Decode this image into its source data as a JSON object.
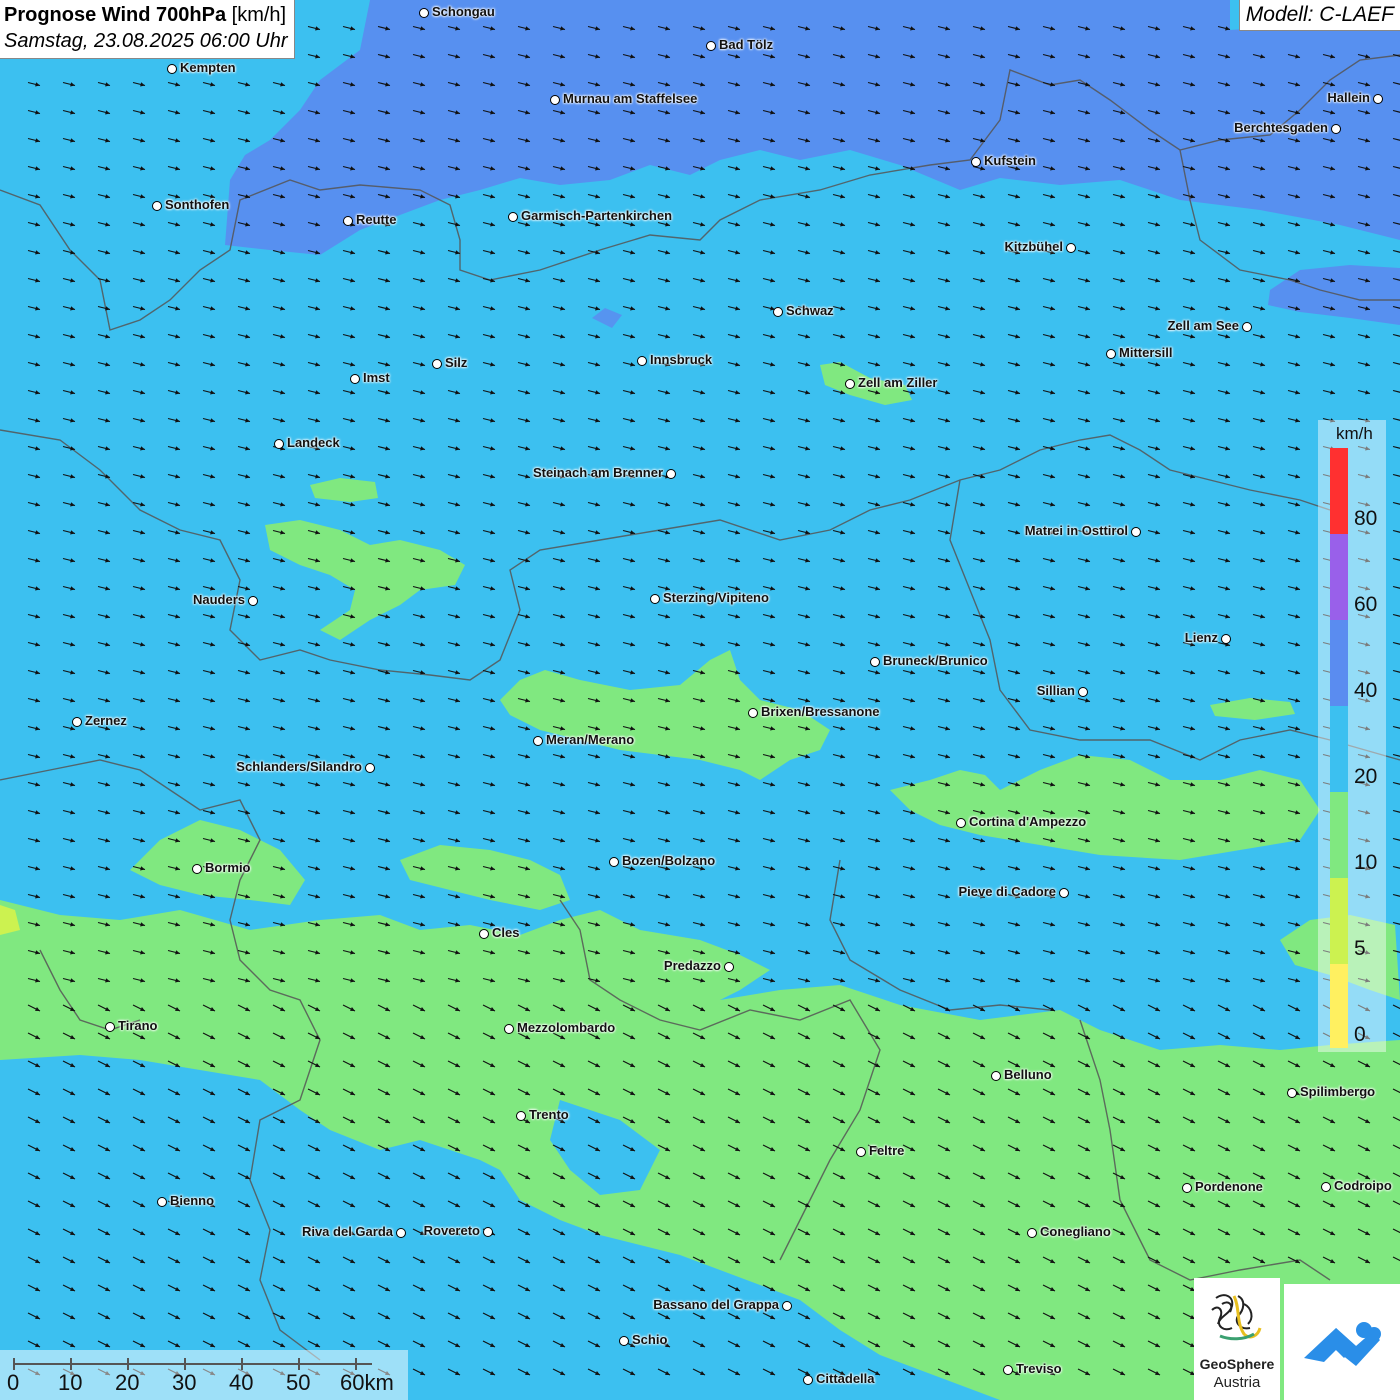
{
  "title": {
    "main_bold": "Prognose Wind 700hPa",
    "unit": "[km/h]",
    "datetime": "Samstag, 23.08.2025 06:00 Uhr"
  },
  "model_label": "Modell: C-LAEF",
  "legend": {
    "unit": "km/h",
    "labels": [
      "80",
      "60",
      "40",
      "20",
      "10",
      "5",
      "0"
    ],
    "colors": {
      "above80": "#ff3030",
      "60_80": "#9960ea",
      "40_60": "#5a8cf0",
      "20_40": "#3cc0f0",
      "10_20": "#80e880",
      "5_10": "#ccf250",
      "0_5": "#fff060"
    }
  },
  "map_colors": {
    "base": "#3cc0f0",
    "strong": "#5a8cf0",
    "weak": "#80e880",
    "border": "#555555"
  },
  "cities": [
    {
      "name": "Schongau"
    },
    {
      "name": "Bad Tölz"
    },
    {
      "name": "Kempten"
    },
    {
      "name": "Murnau am Staffelsee"
    },
    {
      "name": "Hallein"
    },
    {
      "name": "Berchtesgaden"
    },
    {
      "name": "Kufstein"
    },
    {
      "name": "Sonthofen"
    },
    {
      "name": "Reutte"
    },
    {
      "name": "Garmisch-Partenkirchen"
    },
    {
      "name": "Kitzbühel"
    },
    {
      "name": "Schwaz"
    },
    {
      "name": "Zell am See"
    },
    {
      "name": "Mittersill"
    },
    {
      "name": "Silz"
    },
    {
      "name": "Innsbruck"
    },
    {
      "name": "Imst"
    },
    {
      "name": "Zell am Ziller"
    },
    {
      "name": "Landeck"
    },
    {
      "name": "Steinach am Brenner"
    },
    {
      "name": "Matrei in Osttirol"
    },
    {
      "name": "Nauders"
    },
    {
      "name": "Sterzing/Vipiteno"
    },
    {
      "name": "Lienz"
    },
    {
      "name": "Bruneck/Brunico"
    },
    {
      "name": "Sillian"
    },
    {
      "name": "Brixen/Bressanone"
    },
    {
      "name": "Zernez"
    },
    {
      "name": "Meran/Merano"
    },
    {
      "name": "Schlanders/Silandro"
    },
    {
      "name": "Cortina d'Ampezzo"
    },
    {
      "name": "Bozen/Bolzano"
    },
    {
      "name": "Bormio"
    },
    {
      "name": "Pieve di Cadore"
    },
    {
      "name": "Cles"
    },
    {
      "name": "Predazzo"
    },
    {
      "name": "Tirano"
    },
    {
      "name": "Mezzolombardo"
    },
    {
      "name": "Belluno"
    },
    {
      "name": "Spilimbergo"
    },
    {
      "name": "Trento"
    },
    {
      "name": "Feltre"
    },
    {
      "name": "Pordenone"
    },
    {
      "name": "Codroipo"
    },
    {
      "name": "Bienno"
    },
    {
      "name": "Riva del Garda"
    },
    {
      "name": "Rovereto"
    },
    {
      "name": "Conegliano"
    },
    {
      "name": "Bassano del Grappa"
    },
    {
      "name": "Schio"
    },
    {
      "name": "Treviso"
    },
    {
      "name": "Cittadella"
    }
  ],
  "scale_bar": {
    "labels": [
      "0",
      "10",
      "20",
      "30",
      "40",
      "50",
      "60km"
    ]
  },
  "logos": {
    "geosphere_line1": "GeoSphere",
    "geosphere_line2": "Austria"
  }
}
